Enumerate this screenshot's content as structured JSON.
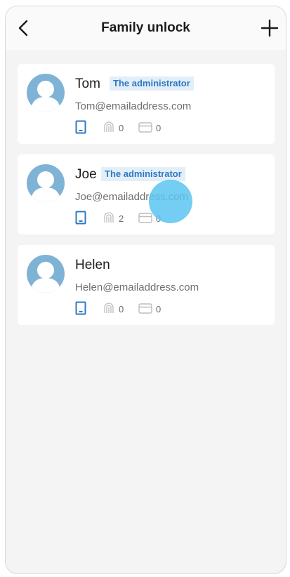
{
  "header": {
    "title": "Family unlock",
    "back_icon": "chevron-left-icon",
    "add_icon": "plus-icon"
  },
  "members": [
    {
      "name": "Tom",
      "role": "The administrator",
      "email": "Tom@emailaddress.com",
      "fingerprints": "0",
      "cards": "0"
    },
    {
      "name": "Joe",
      "role": "The administrator",
      "email": "Joe@emailaddress.com",
      "fingerprints": "2",
      "cards": "0"
    },
    {
      "name": "Helen",
      "role": "",
      "email": "Helen@emailaddress.com",
      "fingerprints": "0",
      "cards": "0"
    }
  ],
  "colors": {
    "accent": "#2f78c2",
    "avatar": "#7fb3d6",
    "badge_bg": "#e3eff8",
    "touch_indicator": "#5cc4f0"
  }
}
